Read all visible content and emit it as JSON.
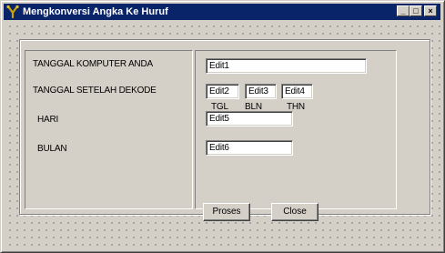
{
  "window": {
    "title": "Mengkonversi Angka Ke Huruf",
    "icon": "app-icon",
    "controls": {
      "minimize": "_",
      "maximize": "□",
      "close": "×"
    }
  },
  "labels": {
    "tanggal_komputer": "TANGGAL KOMPUTER ANDA",
    "tanggal_setelah": "TANGGAL SETELAH DEKODE",
    "hari": "HARI",
    "bulan": "BULAN",
    "tgl": "TGL",
    "bln": "BLN",
    "thn": "THN"
  },
  "fields": {
    "edit1": "Edit1",
    "edit2": "Edit2",
    "edit3": "Edit3",
    "edit4": "Edit4",
    "edit5": "Edit5",
    "edit6": "Edit6"
  },
  "buttons": {
    "proses": "Proses",
    "close": "Close"
  },
  "colors": {
    "title_bar": "#0a246a",
    "face": "#d4d0c8"
  }
}
